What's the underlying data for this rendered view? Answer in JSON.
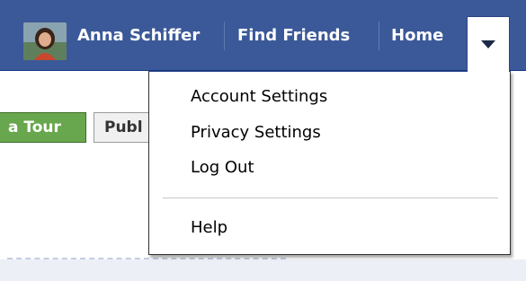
{
  "topbar": {
    "user_name": "Anna Schiffer",
    "find_friends": "Find Friends",
    "home": "Home"
  },
  "content": {
    "tour_button": "a Tour",
    "public_button": "Publ"
  },
  "menu": {
    "account_settings": "Account Settings",
    "privacy_settings": "Privacy Settings",
    "log_out": "Log Out",
    "help": "Help"
  },
  "colors": {
    "topbar_bg": "#3b5998",
    "tour_button_bg": "#69a74e",
    "menu_bg": "#ffffff"
  },
  "icons": {
    "dropdown": "triangle-down-icon",
    "avatar": "user-avatar"
  }
}
